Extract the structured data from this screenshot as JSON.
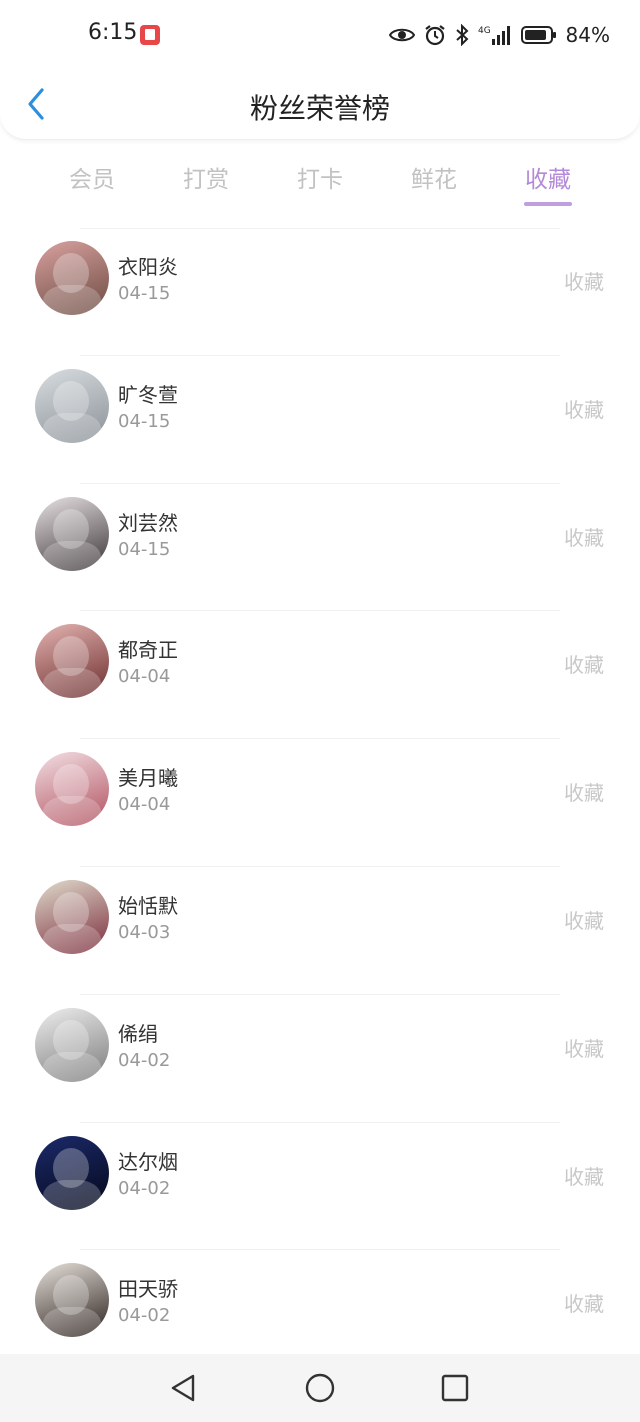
{
  "status_bar": {
    "time": "6:15",
    "battery_text": "84%",
    "network_label": "4G"
  },
  "header": {
    "title": "粉丝荣誉榜"
  },
  "tabs": [
    {
      "label": "会员",
      "active": false
    },
    {
      "label": "打赏",
      "active": false
    },
    {
      "label": "打卡",
      "active": false
    },
    {
      "label": "鲜花",
      "active": false
    },
    {
      "label": "收藏",
      "active": true
    }
  ],
  "accent_color": "#b48ad8",
  "back_color": "#2b8fe0",
  "fans": [
    {
      "name": "衣阳炎",
      "date": "04-15",
      "action": "收藏",
      "avatar_colors": [
        "#d9a2a0",
        "#6b4a40"
      ]
    },
    {
      "name": "旷冬萱",
      "date": "04-15",
      "action": "收藏",
      "avatar_colors": [
        "#d8dde0",
        "#8a9097"
      ]
    },
    {
      "name": "刘芸然",
      "date": "04-15",
      "action": "收藏",
      "avatar_colors": [
        "#e8e2e4",
        "#3a3335"
      ]
    },
    {
      "name": "都奇正",
      "date": "04-04",
      "action": "收藏",
      "avatar_colors": [
        "#e4b4b2",
        "#6a2b2b"
      ]
    },
    {
      "name": "美月曦",
      "date": "04-04",
      "action": "收藏",
      "avatar_colors": [
        "#f3dfe4",
        "#b0505e"
      ]
    },
    {
      "name": "始恬默",
      "date": "04-03",
      "action": "收藏",
      "avatar_colors": [
        "#e0dccd",
        "#7a2a3a"
      ]
    },
    {
      "name": "俙绢",
      "date": "04-02",
      "action": "收藏",
      "avatar_colors": [
        "#eeeeee",
        "#7a7a7a"
      ]
    },
    {
      "name": "达尔烟",
      "date": "04-02",
      "action": "收藏",
      "avatar_colors": [
        "#1c2a6a",
        "#04081a"
      ]
    },
    {
      "name": "田天骄",
      "date": "04-02",
      "action": "收藏",
      "avatar_colors": [
        "#e7e2dc",
        "#2a1e1a"
      ]
    }
  ]
}
